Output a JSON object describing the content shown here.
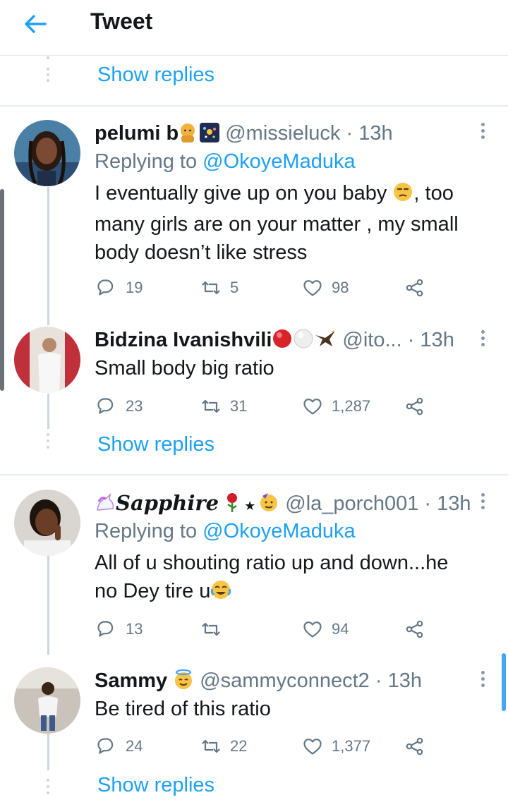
{
  "header": {
    "title": "Tweet"
  },
  "colors": {
    "accent": "#1da1f2",
    "muted": "#657786",
    "text": "#14171a"
  },
  "show_replies_top": "Show replies",
  "show_replies_mid": "Show replies",
  "show_replies_bottom": "Show replies",
  "tweets": [
    {
      "name": "pelumi b",
      "handle": "@missieluck",
      "time": "· 13h",
      "replying_prefix": "Replying to",
      "replying_handle": "@OkoyeMaduka",
      "lines": [
        "I eventually give up on you baby",
        ", too",
        "many girls are on your matter , my small",
        "body doesn’t like stress"
      ],
      "replies": "19",
      "retweets": "5",
      "likes": "98"
    },
    {
      "name": "Bidzina Ivanishvili",
      "handle": "@ito...",
      "time": "· 13h",
      "lines": [
        "Small body big ratio"
      ],
      "replies": "23",
      "retweets": "31",
      "likes": "1,287"
    },
    {
      "name": "Sapphire",
      "handle": "@la_porch001",
      "time": "· 13h",
      "replying_prefix": "Replying to",
      "replying_handle": "@OkoyeMaduka",
      "lines": [
        "All of u shouting ratio up and down...he",
        "no Dey tire u"
      ],
      "replies": "13",
      "retweets": "",
      "likes": "94"
    },
    {
      "name": "Sammy",
      "handle": "@sammyconnect2",
      "time": "· 13h",
      "lines": [
        "Be tired of this ratio"
      ],
      "replies": "24",
      "retweets": "22",
      "likes": "1,377"
    }
  ],
  "icons": [
    "back-arrow-icon",
    "reply-icon",
    "retweet-icon",
    "like-icon",
    "share-icon",
    "more-icon"
  ]
}
